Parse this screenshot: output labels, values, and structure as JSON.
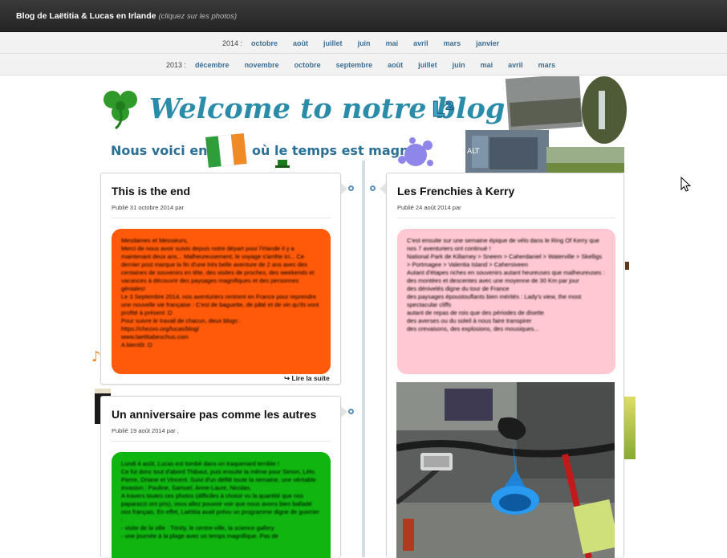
{
  "header": {
    "title": "Blog de Laëtitia & Lucas en Irlande",
    "subtitle": "(cliquez sur les photos)"
  },
  "archives": [
    {
      "year": "2014 :",
      "months": [
        "octobre",
        "août",
        "juillet",
        "juin",
        "mai",
        "avril",
        "mars",
        "janvier"
      ]
    },
    {
      "year": "2013 :",
      "months": [
        "décembre",
        "novembre",
        "octobre",
        "septembre",
        "août",
        "juillet",
        "juin",
        "mai",
        "avril",
        "mars"
      ]
    }
  ],
  "banner": {
    "title": "Welcome to notre blog",
    "logo": "L²",
    "tagline": "Nous voici en",
    "tagline_end": "où le temps est magnif",
    "sign_text": "ALT"
  },
  "posts": [
    {
      "title": "This is the end",
      "meta": "Publié 31 octobre 2014 par",
      "excerpt": "Mesdames et Messieurs,\nMerci de nous avoir suivis depuis notre départ pour l'Irlande il y a maintenant deux ans... Malheureusement, le voyage s'arrête ici... Ce dernier post marque la fin d'une très belle aventure de 2 ans avec des centaines de souvenirs en tête, des visites de proches, des weekends et vacances à découvrir des paysages magnifiques et des personnes géniales!\nLe 3 Septembre 2014, nos aventuriers rentrent en France pour reprendre une nouvelle vie française : C'est de baguette, de pâté et de vin qu'ils vont profité à présent :D\nPour suivre le travail de chacun, deux blogs :\nhttps://chezxo.org/lucas/blog/\nwww.laetitiabeschus.com\nA bientôt :D",
      "excerpt_color": "#ff5a0a",
      "readmore": "Lire la suite",
      "readmore_icon": "return-arrow-icon"
    },
    {
      "title": "Un anniversaire pas comme les autres",
      "meta": "Publié 19 août 2014 par ,",
      "excerpt": "Lundi 4 août, Lucas est tombé dans un traquenard terrible !\nCe fut donc tout d'abord Thibaut, puis ensuite la même pour Simon, Lélo, Pierre, Oriane et Vincent. Suivi d'un défilé toute la semaine, une véritable invasion : Pauline, Samuel, Anne-Laure, Nicolas.\nA travers toutes ces photos (difficiles à choisir vu la quantité que nos paparazzi ont pris), vous allez pouvoir voir que nous avons bien balladé nos français. En effet, Laëtitia avait prévu un programme digne de guerrier :\n- visite de la ville : Trinity, le centre-ville, la science gallery\n- une journée à la plage avec un temps magnifique. Pas de",
      "excerpt_color": "#10b510"
    },
    {
      "title": "Les Frenchies à Kerry",
      "meta": "Publié 24 août 2014 par",
      "excerpt": "C'est ensuite sur une semaine épique de vélo dans le Ring Of Kerry que nos 7 aventuriers ont continué !\nNational Park de Killarney > Sneem > Caherdaniel > Waterville > Skelligs > Portmagee > Valentia Island > Cahersiveen\nAutant d'étapes riches en souvenirs autant heureuses que malheureuses :\ndes montées et descentes avec une moyenne de 30 Km par jour\ndes dénivelés digne du tour de France\ndes paysages époustouflants bien mérités : Lady's view, the most spectacular cliffs\nautant de repas de rois que des périodes de disette\ndes averses ou du soleil à nous faire transpirer\ndes crevaisons, des explosions, des mousiques...",
      "excerpt_color": "#ffc8d2",
      "photo": "bicycle-horn-photo"
    }
  ],
  "colors": {
    "accent": "#3c6f95",
    "timeline": "#d3dde3",
    "topbar": "#2e2e2e"
  }
}
